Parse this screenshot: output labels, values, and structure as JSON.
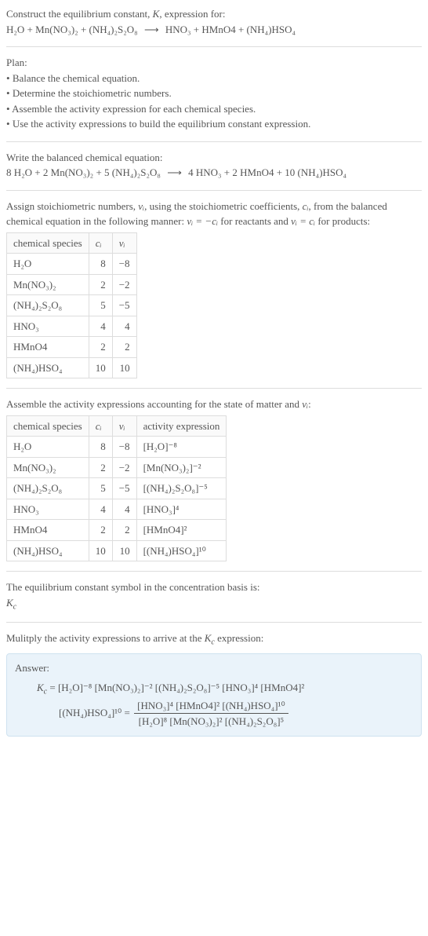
{
  "intro": {
    "line1_prefix": "Construct the equilibrium constant, ",
    "line1_k": "K",
    "line1_suffix": ", expression for:",
    "equation_lhs": "H₂O + Mn(NO₃)₂ + (NH₄)₂S₂O₈",
    "arrow": "⟶",
    "equation_rhs": "HNO₃ + HMnO4 + (NH₄)HSO₄"
  },
  "plan": {
    "heading": "Plan:",
    "items": [
      "Balance the chemical equation.",
      "Determine the stoichiometric numbers.",
      "Assemble the activity expression for each chemical species.",
      "Use the activity expressions to build the equilibrium constant expression."
    ]
  },
  "balanced": {
    "heading": "Write the balanced chemical equation:",
    "equation_lhs": "8 H₂O + 2 Mn(NO₃)₂ + 5 (NH₄)₂S₂O₈",
    "arrow": "⟶",
    "equation_rhs": "4 HNO₃ + 2 HMnO4 + 10 (NH₄)HSO₄"
  },
  "assign": {
    "line1_a": "Assign stoichiometric numbers, ",
    "line1_nu": "νᵢ",
    "line1_b": ", using the stoichiometric coefficients, ",
    "line1_c": "cᵢ",
    "line1_d": ", from the balanced chemical equation in the following manner: ",
    "line1_eq": "νᵢ = −cᵢ",
    "line1_e": " for reactants and ",
    "line1_eq2": "νᵢ = cᵢ",
    "line1_f": " for products:",
    "cols": {
      "species": "chemical species",
      "ci": "cᵢ",
      "nui": "νᵢ"
    },
    "rows": [
      {
        "species": "H₂O",
        "ci": "8",
        "nui": "−8"
      },
      {
        "species": "Mn(NO₃)₂",
        "ci": "2",
        "nui": "−2"
      },
      {
        "species": "(NH₄)₂S₂O₈",
        "ci": "5",
        "nui": "−5"
      },
      {
        "species": "HNO₃",
        "ci": "4",
        "nui": "4"
      },
      {
        "species": "HMnO4",
        "ci": "2",
        "nui": "2"
      },
      {
        "species": "(NH₄)HSO₄",
        "ci": "10",
        "nui": "10"
      }
    ]
  },
  "activity": {
    "heading_a": "Assemble the activity expressions accounting for the state of matter and ",
    "heading_nu": "νᵢ",
    "heading_b": ":",
    "cols": {
      "species": "chemical species",
      "ci": "cᵢ",
      "nui": "νᵢ",
      "act": "activity expression"
    },
    "rows": [
      {
        "species": "H₂O",
        "ci": "8",
        "nui": "−8",
        "act": "[H₂O]⁻⁸"
      },
      {
        "species": "Mn(NO₃)₂",
        "ci": "2",
        "nui": "−2",
        "act": "[Mn(NO₃)₂]⁻²"
      },
      {
        "species": "(NH₄)₂S₂O₈",
        "ci": "5",
        "nui": "−5",
        "act": "[(NH₄)₂S₂O₈]⁻⁵"
      },
      {
        "species": "HNO₃",
        "ci": "4",
        "nui": "4",
        "act": "[HNO₃]⁴"
      },
      {
        "species": "HMnO4",
        "ci": "2",
        "nui": "2",
        "act": "[HMnO4]²"
      },
      {
        "species": "(NH₄)HSO₄",
        "ci": "10",
        "nui": "10",
        "act": "[(NH₄)HSO₄]¹⁰"
      }
    ]
  },
  "symbol": {
    "heading": "The equilibrium constant symbol in the concentration basis is:",
    "kc": "K_c"
  },
  "multiply": {
    "heading_a": "Mulitply the activity expressions to arrive at the ",
    "heading_k": "K_c",
    "heading_b": " expression:"
  },
  "answer": {
    "label": "Answer:",
    "line1": "K_c = [H₂O]⁻⁸ [Mn(NO₃)₂]⁻² [(NH₄)₂S₂O₈]⁻⁵ [HNO₃]⁴ [HMnO4]²",
    "line2_left": "[(NH₄)HSO₄]¹⁰ = ",
    "frac_num": "[HNO₃]⁴ [HMnO4]² [(NH₄)HSO₄]¹⁰",
    "frac_den": "[H₂O]⁸ [Mn(NO₃)₂]² [(NH₄)₂S₂O₈]⁵"
  }
}
